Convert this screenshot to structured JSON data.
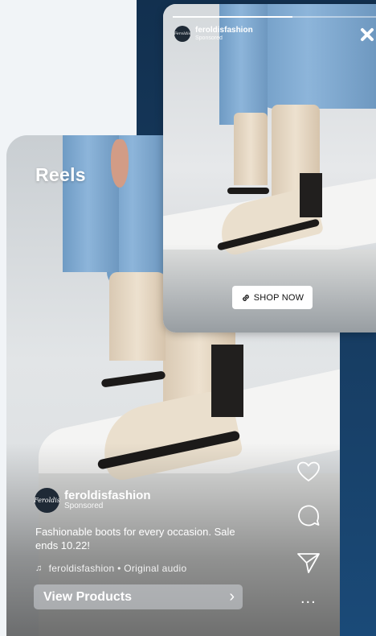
{
  "reel": {
    "title": "Reels",
    "account_name": "feroldisfashion",
    "account_sub": "Sponsored",
    "avatar_text": "Feroldis",
    "caption": "Fashionable boots for every occasion. Sale ends 10.22!",
    "audio": "feroldisfashion • Original audio",
    "view_button": "View Products",
    "more": "..."
  },
  "story": {
    "account_name": "feroldisfashion",
    "account_sub": "Sponsored",
    "avatar_text": "Feroldis",
    "progress": 0.59,
    "shop_button": "SHOP NOW"
  },
  "icons": {
    "like": "heart-icon",
    "comment": "comment-icon",
    "share": "send-icon",
    "more": "more-icon",
    "close": "close-icon",
    "link": "link-icon",
    "music": "music-note-icon",
    "chevron": "chevron-right-icon"
  },
  "colors": {
    "navy": "#173d63",
    "page_bg": "#f1f4f7",
    "boot": "#ede1cf",
    "jeans": "#8db5da"
  }
}
